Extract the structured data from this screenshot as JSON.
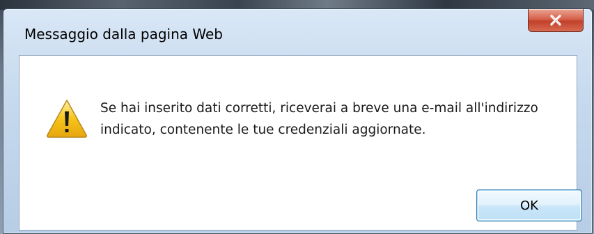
{
  "window": {
    "title": "Messaggio dalla pagina Web"
  },
  "message": {
    "line1": "Se hai inserito dati corretti, riceverai a breve una e-mail all'indirizzo",
    "line2": "indicato, contenente le tue credenziali aggiornate."
  },
  "buttons": {
    "ok_label": "OK"
  },
  "icons": {
    "close": "close-icon",
    "warning": "warning-icon"
  },
  "colors": {
    "close_button": "#c7442c",
    "warning_fill": "#f6c519",
    "ok_border": "#3c7fb1"
  }
}
